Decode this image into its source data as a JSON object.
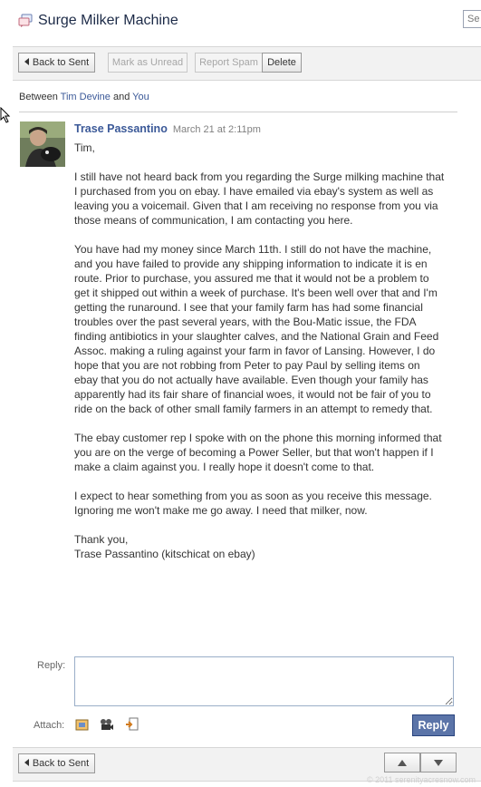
{
  "header": {
    "title": "Surge Milker Machine",
    "search_stub": "Se"
  },
  "toolbar": {
    "back_label": "Back to Sent",
    "mark_unread_label": "Mark as Unread",
    "report_spam_label": "Report Spam",
    "delete_label": "Delete"
  },
  "conversation": {
    "between_prefix": "Between",
    "participant_1": "Tim Devine",
    "and": "and",
    "participant_2": "You"
  },
  "message": {
    "sender": "Trase Passantino",
    "date": "March 21 at 2:11pm",
    "paragraphs": [
      "Tim,",
      "I still have not heard back from you regarding the Surge milking machine that I purchased from you on ebay. I have emailed via ebay's system as well as leaving you a voicemail. Given that I am receiving no response from you via those means of communication, I am contacting you here.",
      "You have had my money since March 11th. I still do not have the machine, and you have failed to provide any shipping information to indicate it is en route. Prior to purchase, you assured me that it would not be a problem to get it shipped out within a week of purchase. It's been well over that and I'm getting the runaround. I see that your family farm has had some financial troubles over the past several years, with the Bou-Matic issue, the FDA finding antibiotics in your slaughter calves, and the National Grain and Feed Assoc. making a ruling against your farm in favor of Lansing. However, I do hope that you are not robbing from Peter to pay Paul by selling items on ebay that you do not actually have available. Even though your family has apparently had its fair share of financial woes, it would not be fair of you to ride on the back of other small family farmers in an attempt to remedy that.",
      "The ebay customer rep I spoke with on the phone this morning informed that you are on the verge of becoming a Power Seller, but that won't happen if I make a claim against you. I really hope it doesn't come to that.",
      "I expect to hear something from you as soon as you receive this message. Ignoring me won't make me go away. I need that milker, now.",
      "Thank you,",
      "Trase Passantino (kitschicat on ebay)"
    ]
  },
  "reply": {
    "label": "Reply:",
    "value": "",
    "attach_label": "Attach:",
    "attach_icons": [
      "photo-icon",
      "video-icon",
      "link-share-icon"
    ],
    "button_label": "Reply"
  },
  "footer": {
    "back_label": "Back to Sent",
    "nav_icons": [
      "up-arrow-icon",
      "down-arrow-icon"
    ],
    "watermark": "© 2011 serenityacresnow.com"
  },
  "colors": {
    "link": "#3b5998",
    "reply_button": "#5b74a8"
  }
}
